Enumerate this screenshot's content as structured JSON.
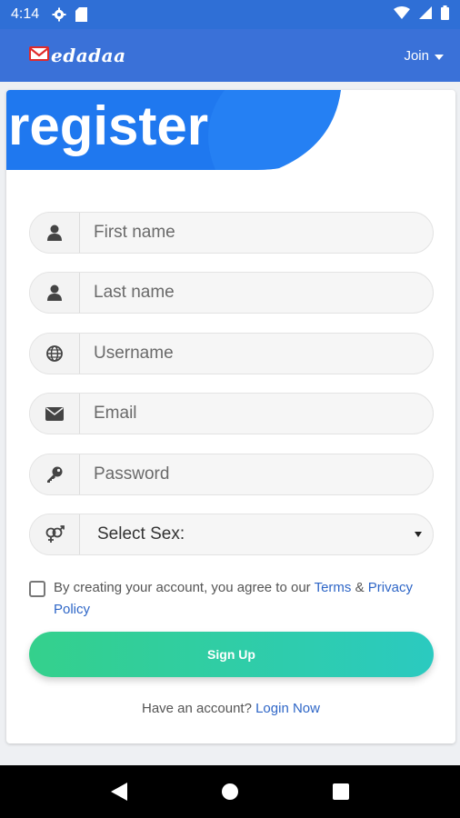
{
  "status_bar": {
    "time": "4:14",
    "icons": [
      "gear-icon",
      "sd-card-icon",
      "wifi-icon",
      "signal-icon",
      "battery-icon"
    ]
  },
  "app_bar": {
    "logo_text": "edadaa",
    "join_label": "Join"
  },
  "register": {
    "title": "register",
    "fields": [
      {
        "icon": "user-icon",
        "placeholder": "First name"
      },
      {
        "icon": "user-icon",
        "placeholder": "Last name"
      },
      {
        "icon": "globe-icon",
        "placeholder": "Username"
      },
      {
        "icon": "envelope-icon",
        "placeholder": "Email"
      },
      {
        "icon": "key-icon",
        "placeholder": "Password"
      }
    ],
    "sex_select": {
      "icon": "gender-icon",
      "value": "Select Sex:"
    },
    "agree": {
      "text": "By creating your account, you agree to our",
      "terms": "Terms",
      "amp": "&",
      "privacy": "Privacy Policy",
      "checked": false
    },
    "signup_label": "Sign Up",
    "have_account": "Have an account?",
    "login_link": "Login Now"
  },
  "colors": {
    "app_bar": "#3a71d8",
    "banner": "#1e78f0",
    "button_start": "#34d08c",
    "button_end": "#2bcac0",
    "link": "#2e66c7"
  }
}
